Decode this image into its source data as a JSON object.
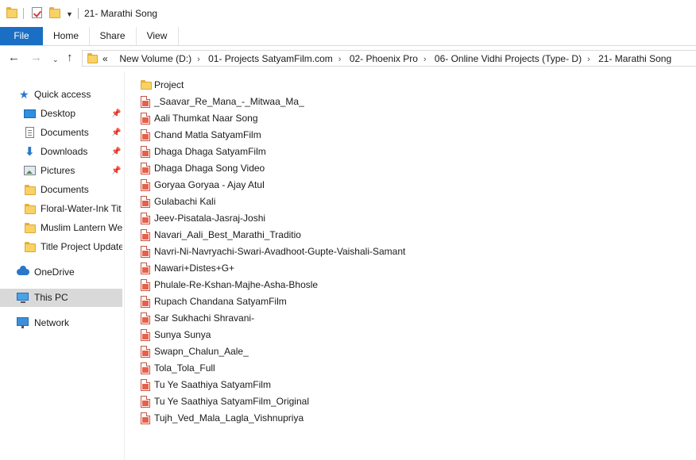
{
  "window": {
    "title": "21- Marathi Song"
  },
  "ribbon": {
    "tabs": [
      "File",
      "Home",
      "Share",
      "View"
    ]
  },
  "address": {
    "overflow": "«",
    "crumbs": [
      "New Volume (D:)",
      "01- Projects SatyamFilm.com",
      "02- Phoenix Pro",
      "06- Online Vidhi Projects (Type- D)",
      "21- Marathi Song"
    ]
  },
  "sidebar": {
    "quick_access": "Quick access",
    "pinned": [
      {
        "label": "Desktop",
        "icon": "desktop-icon"
      },
      {
        "label": "Documents",
        "icon": "documents-icon"
      },
      {
        "label": "Downloads",
        "icon": "downloads-icon"
      },
      {
        "label": "Pictures",
        "icon": "pictures-icon"
      }
    ],
    "recent": [
      "Documents",
      "Floral-Water-Ink Tit",
      "Muslim Lantern We",
      "Title Project Update"
    ],
    "onedrive": "OneDrive",
    "this_pc": "This PC",
    "network": "Network"
  },
  "files": [
    {
      "name": "Project",
      "type": "folder"
    },
    {
      "name": "_Saavar_Re_Mana_-_Mitwaa_Ma_",
      "type": "pdf"
    },
    {
      "name": "Aali Thumkat Naar Song",
      "type": "pdf"
    },
    {
      "name": "Chand Matla SatyamFilm",
      "type": "pdf"
    },
    {
      "name": "Dhaga Dhaga SatyamFilm",
      "type": "pdf"
    },
    {
      "name": "Dhaga Dhaga Song Video",
      "type": "pdf"
    },
    {
      "name": "Goryaa Goryaa - Ajay Atul",
      "type": "pdf"
    },
    {
      "name": "Gulabachi Kali",
      "type": "pdf"
    },
    {
      "name": "Jeev-Pisatala-Jasraj-Joshi",
      "type": "pdf"
    },
    {
      "name": "Navari_Aali_Best_Marathi_Traditio",
      "type": "pdf"
    },
    {
      "name": "Navri-Ni-Navryachi-Swari-Avadhoot-Gupte-Vaishali-Samant",
      "type": "pdf"
    },
    {
      "name": "Nawari+Distes+G+",
      "type": "pdf"
    },
    {
      "name": "Phulale-Re-Kshan-Majhe-Asha-Bhosle",
      "type": "pdf"
    },
    {
      "name": "Rupach Chandana SatyamFilm",
      "type": "pdf"
    },
    {
      "name": "Sar Sukhachi Shravani-",
      "type": "pdf"
    },
    {
      "name": "Sunya Sunya",
      "type": "pdf"
    },
    {
      "name": "Swapn_Chalun_Aale_",
      "type": "pdf"
    },
    {
      "name": "Tola_Tola_Full",
      "type": "pdf"
    },
    {
      "name": "Tu Ye Saathiya SatyamFilm",
      "type": "pdf"
    },
    {
      "name": "Tu Ye Saathiya SatyamFilm_Original",
      "type": "pdf"
    },
    {
      "name": "Tujh_Ved_Mala_Lagla_Vishnupriya",
      "type": "pdf"
    }
  ]
}
